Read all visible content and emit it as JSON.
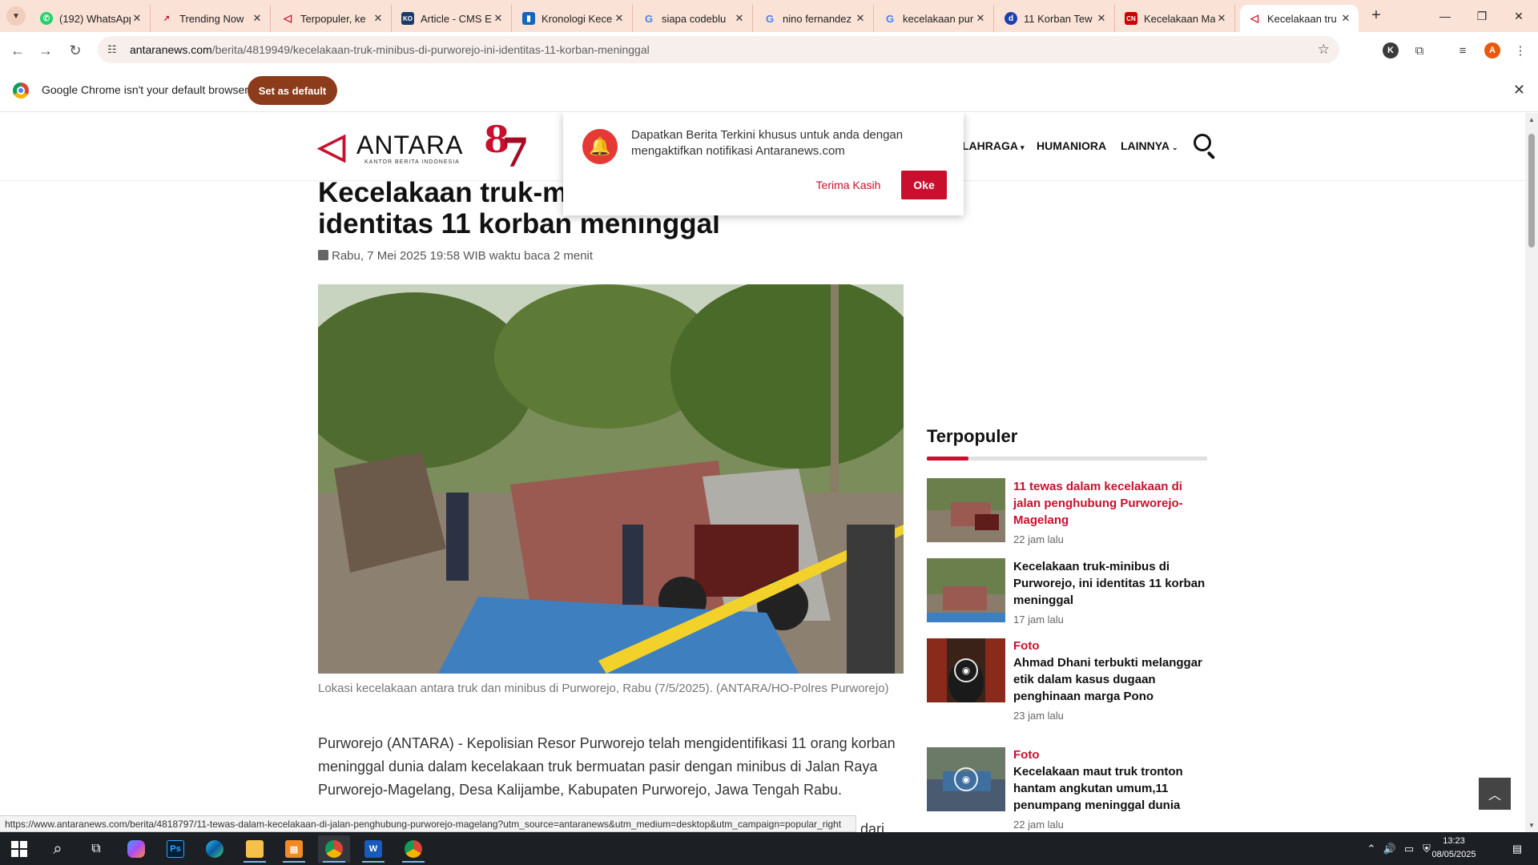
{
  "tabs": [
    {
      "title": "(192) WhatsApp",
      "fav_color": "#25d366",
      "fav_glyph": "✆",
      "icon": "whatsapp-icon"
    },
    {
      "title": "Trending Now",
      "fav_color": "#ffffff",
      "fav_glyph": "↗",
      "icon": "trending-icon"
    },
    {
      "title": "Terpopuler, ke",
      "fav_color": "#ffffff",
      "fav_glyph": "◁",
      "icon": "antara-icon"
    },
    {
      "title": "Article - CMS E",
      "fav_color": "#1a3a6b",
      "fav_glyph": "KO",
      "icon": "cms-icon"
    },
    {
      "title": "Kronologi Kece",
      "fav_color": "#1565c0",
      "fav_glyph": "▮",
      "icon": "doc-icon"
    },
    {
      "title": "siapa codeblu",
      "fav_color": "#ffffff",
      "fav_glyph": "G",
      "icon": "google-icon"
    },
    {
      "title": "nino fernandez",
      "fav_color": "#ffffff",
      "fav_glyph": "G",
      "icon": "google-icon"
    },
    {
      "title": "kecelakaan pur",
      "fav_color": "#ffffff",
      "fav_glyph": "G",
      "icon": "google-icon"
    },
    {
      "title": "11 Korban Tew",
      "fav_color": "#1e40af",
      "fav_glyph": "d",
      "icon": "detik-icon"
    },
    {
      "title": "Kecelakaan Ma",
      "fav_color": "#cc0000",
      "fav_glyph": "CN",
      "icon": "cnn-icon"
    },
    {
      "title": "Kecelakaan tru",
      "fav_color": "#ffffff",
      "fav_glyph": "◁",
      "icon": "antara-icon",
      "active": true
    }
  ],
  "omnibox": {
    "host": "antaranews.com",
    "path": "/berita/4819949/kecelakaan-truk-minibus-di-purworejo-ini-identitas-11-korban-meninggal"
  },
  "profile": {
    "k": "K",
    "a": "A"
  },
  "infobar": {
    "message": "Google Chrome isn't your default browser",
    "button": "Set as default"
  },
  "site": {
    "logo_word": "ANTARA",
    "logo_sub": "KANTOR BERITA INDONESIA",
    "anniv_8": "8",
    "anniv_7": "7",
    "nav": [
      "LAHRAGA",
      "HUMANIORA",
      "LAINNYA"
    ]
  },
  "notification": {
    "message": "Dapatkan Berita Terkini khusus untuk anda dengan mengaktifkan notifikasi Antaranews.com",
    "decline": "Terima Kasih",
    "accept": "Oke"
  },
  "article": {
    "headline": "Kecelakaan truk-minibus di Purworejo, ini identitas 11 korban meninggal",
    "date": "Rabu, 7 Mei 2025 19:58 WIB",
    "read_time": "waktu baca 2 menit",
    "caption": "Lokasi kecelakaan antara truk dan minibus di Purworejo, Rabu (7/5/2025). (ANTARA/HO-Polres Purworejo)",
    "body": "Purworejo (ANTARA) - Kepolisian Resor Purworejo telah mengidentifikasi 11 orang korban meninggal dunia dalam kecelakaan truk bermuatan pasir dengan minibus di Jalan Raya Purworejo-Magelang, Desa Kalijambe, Kabupaten Purworejo, Jawa Tengah Rabu.",
    "body_cut": "dari"
  },
  "sidebar": {
    "title": "Terpopuler",
    "items": [
      {
        "category": "",
        "title": "11 tewas dalam kecelakaan di jalan penghubung Purworejo-Magelang",
        "time": "22 jam lalu",
        "hover": true
      },
      {
        "category": "",
        "title": "Kecelakaan truk-minibus di Purworejo, ini identitas 11 korban meninggal",
        "time": "17 jam lalu"
      },
      {
        "category": "Foto",
        "title": "Ahmad Dhani terbukti melanggar etik dalam kasus dugaan penghinaan marga Pono",
        "time": "23 jam lalu"
      },
      {
        "category": "Foto",
        "title": "Kecelakaan maut truk tronton hantam angkutan umum,11 penumpang meninggal dunia",
        "time": "22 jam lalu"
      }
    ]
  },
  "status_url": "https://www.antaranews.com/berita/4818797/11-tewas-dalam-kecelakaan-di-jalan-penghubung-purworejo-magelang?utm_source=antaranews&utm_medium=desktop&utm_campaign=popular_right",
  "taskbar": {
    "time": "13:23",
    "date": "08/05/2025"
  },
  "colors": {
    "brand_red": "#c8102e",
    "tabstrip": "#fbe2d6",
    "set_default": "#8c3c1a"
  }
}
